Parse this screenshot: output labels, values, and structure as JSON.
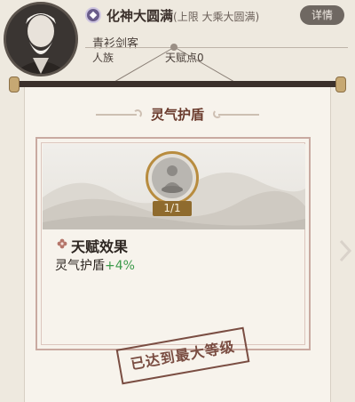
{
  "header": {
    "realm_title": "化神大圆满",
    "realm_limit": "(上限 大乘大圆满)",
    "details_label": "详情",
    "character_name": "青衫剑客",
    "race": "人族",
    "talent_points": "天赋点0"
  },
  "skill": {
    "title": "灵气护盾",
    "level": "1/1",
    "effect_heading": "天赋效果",
    "effect_name": "灵气护盾",
    "effect_bonus": "+4%",
    "max_level_stamp": "已达到最大等级"
  },
  "colors": {
    "bonus_green": "#3c9a4b",
    "stamp_red": "#7a4d42",
    "title_red": "#6a3a2c"
  },
  "icons": [
    "avatar",
    "realm-diamond-icon",
    "skill-emblem-icon",
    "flower-icon",
    "next-arrow-icon"
  ]
}
